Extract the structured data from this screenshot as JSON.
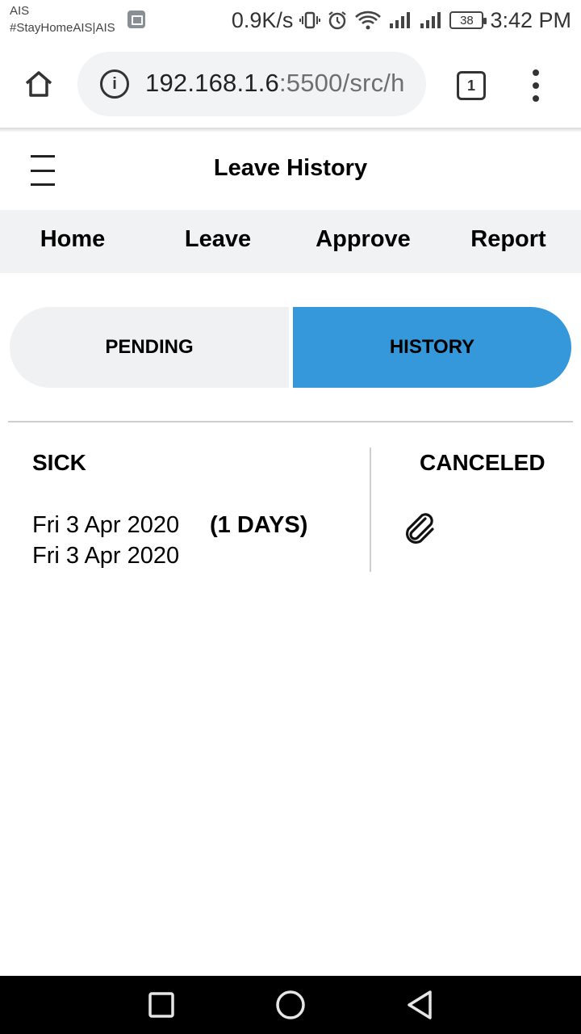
{
  "status_bar": {
    "carrier_line1": "AIS",
    "carrier_line2": "#StayHomeAIS|AIS",
    "net_speed": "0.9K/s",
    "battery": "38",
    "time": "3:42 PM",
    "icons": [
      "gallery-icon",
      "vibrate-icon",
      "alarm-icon",
      "wifi-icon",
      "signal-icon",
      "signal-icon",
      "battery-icon"
    ]
  },
  "browser": {
    "url_host": "192.168.1.6",
    "url_path": ":5500/src/h",
    "tab_count": "1",
    "icons": [
      "home-icon",
      "info-icon",
      "tabs-icon",
      "more-vert-icon"
    ]
  },
  "header": {
    "title": "Leave History",
    "menu_icon": "hamburger-icon"
  },
  "nav": {
    "items": [
      {
        "label": "Home"
      },
      {
        "label": "Leave"
      },
      {
        "label": "Approve"
      },
      {
        "label": "Report"
      }
    ]
  },
  "segments": {
    "pending": "PENDING",
    "history": "HISTORY",
    "active": "history",
    "active_color": "#3498db"
  },
  "leaves": [
    {
      "type": "SICK",
      "start": "Fri 3 Apr 2020",
      "end": "Fri 3 Apr 2020",
      "days": "(1 DAYS)",
      "status": "CANCELED",
      "attachment_icon": "paperclip-icon"
    }
  ],
  "system_nav": {
    "icons": [
      "recents-icon",
      "home-circle-icon",
      "back-icon"
    ]
  }
}
